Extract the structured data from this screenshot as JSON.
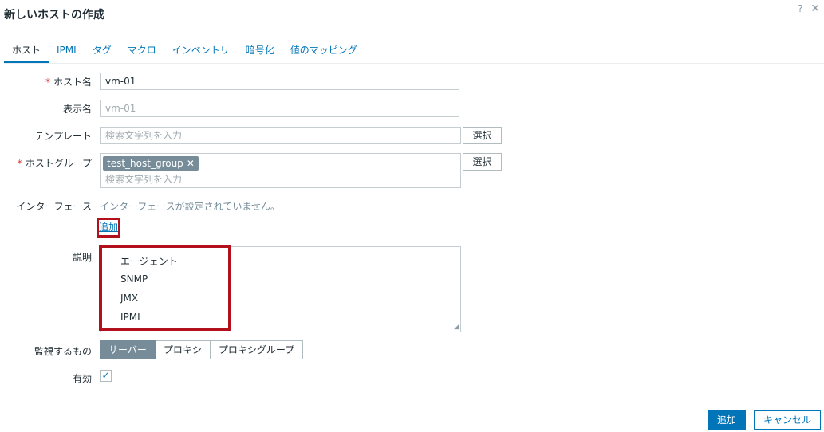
{
  "dialog": {
    "title": "新しいホストの作成",
    "help_icon": "?",
    "close_icon": "✕"
  },
  "tabs": [
    {
      "label": "ホスト",
      "active": true
    },
    {
      "label": "IPMI"
    },
    {
      "label": "タグ"
    },
    {
      "label": "マクロ"
    },
    {
      "label": "インベントリ"
    },
    {
      "label": "暗号化"
    },
    {
      "label": "値のマッピング"
    }
  ],
  "form": {
    "required_mark": "*",
    "host_name": {
      "label": "ホスト名",
      "value": "vm-01"
    },
    "visible_name": {
      "label": "表示名",
      "placeholder": "vm-01"
    },
    "templates": {
      "label": "テンプレート",
      "placeholder": "検索文字列を入力",
      "select_button": "選択"
    },
    "host_groups": {
      "label": "ホストグループ",
      "chip": "test_host_group",
      "chip_remove": "✕",
      "placeholder": "検索文字列を入力",
      "select_button": "選択"
    },
    "interfaces": {
      "label": "インターフェース",
      "message": "インターフェースが設定されていません。",
      "add_link": "追加"
    },
    "description": {
      "label": "説明",
      "resize_icon": "◢"
    },
    "interface_menu": [
      "エージェント",
      "SNMP",
      "JMX",
      "IPMI"
    ],
    "monitored_by": {
      "label": "監視するもの",
      "options": [
        "サーバー",
        "プロキシ",
        "プロキシグループ"
      ],
      "selected": "サーバー"
    },
    "enabled": {
      "label": "有効",
      "checked": true,
      "check_mark": "✓"
    }
  },
  "footer": {
    "add_button": "追加",
    "cancel_button": "キャンセル"
  },
  "colors": {
    "accent": "#0275b8",
    "highlight": "#b3101d",
    "required": "#e33734",
    "chip": "#768d99"
  }
}
